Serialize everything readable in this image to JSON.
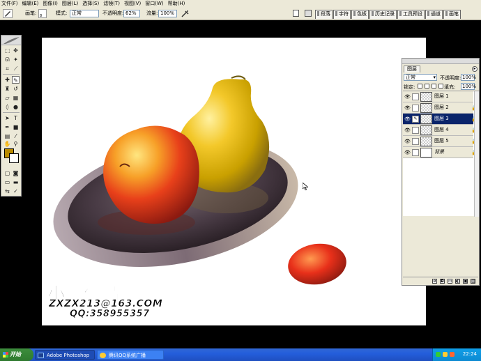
{
  "menu": [
    "文件(F)",
    "编辑(E)",
    "图像(I)",
    "图层(L)",
    "选择(S)",
    "滤镜(T)",
    "视图(V)",
    "窗口(W)",
    "帮助(H)"
  ],
  "options": {
    "brush_label": "画笔:",
    "brush_size": "8",
    "mode_label": "模式:",
    "mode_value": "正常",
    "opacity_label": "不透明度:",
    "opacity_value": "62%",
    "flow_label": "流量:",
    "flow_value": "100%"
  },
  "palette_well": [
    "段落",
    "字符",
    "色板",
    "历史记录",
    "工具预设",
    "通道",
    "画笔"
  ],
  "colors": {
    "foreground": "#b88a00",
    "background": "#ffffff",
    "selected_layer": "#0a246a"
  },
  "signature": {
    "title": "小新作品",
    "email": "ZXZX213@163.COM",
    "qq": "QQ:358955357"
  },
  "layers_panel": {
    "tab": "图层",
    "blend_mode": "正常",
    "opacity_label": "不透明度:",
    "opacity_value": "100%",
    "lock_label": "锁定:",
    "fill_label": "填充:",
    "fill_value": "100%",
    "layers": [
      {
        "name": "图层 1",
        "visible": true,
        "selected": false
      },
      {
        "name": "图层 2",
        "visible": true,
        "selected": false
      },
      {
        "name": "图层 3",
        "visible": true,
        "selected": true
      },
      {
        "name": "图层 4",
        "visible": true,
        "selected": false
      },
      {
        "name": "图层 5",
        "visible": true,
        "selected": false
      },
      {
        "name": "背景",
        "visible": true,
        "selected": false
      }
    ]
  },
  "taskbar": {
    "start": "开始",
    "tasks": [
      "Adobe Photoshop",
      "腾讯QQ系统广播"
    ],
    "clock": "22:24"
  }
}
